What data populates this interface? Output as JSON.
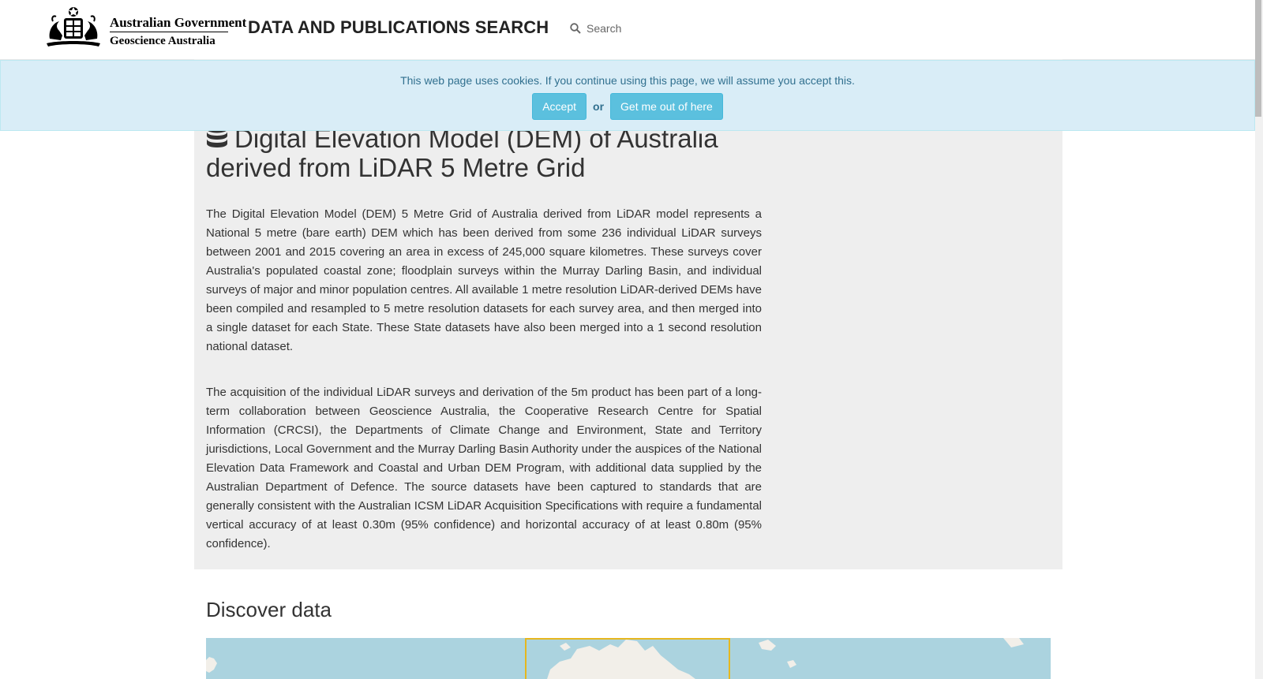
{
  "header": {
    "logo_line_1": "Australian Government",
    "logo_line_2": "Geoscience Australia",
    "site_title": "DATA AND PUBLICATIONS SEARCH",
    "search_label": "Search",
    "search_icon": "search-icon"
  },
  "cookie_banner": {
    "message": "This web page uses cookies. If you continue using this page, we will assume you accept this.",
    "accept_label": "Accept",
    "or_label": "or",
    "opt_out_label": "Get me out of here"
  },
  "record": {
    "icon": "database-icon",
    "title": "Digital Elevation Model (DEM) of Australia derived from LiDAR 5 Metre Grid",
    "paragraph_1": "The Digital Elevation Model (DEM) 5 Metre Grid of Australia derived from LiDAR model represents a National 5 metre (bare earth) DEM which has been derived from some 236 individual LiDAR surveys between 2001 and 2015 covering an area in excess of 245,000 square kilometres. These surveys cover Australia's populated coastal zone; floodplain surveys within the Murray Darling Basin, and individual surveys of major and minor population centres. All available 1 metre resolution LiDAR-derived DEMs have been compiled and resampled to 5 metre resolution datasets for each survey area, and then merged into a single dataset for each State. These State datasets have also been merged into a 1 second resolution national dataset.",
    "paragraph_2": "The acquisition of the individual LiDAR surveys and derivation of the 5m product has been part of a long-term collaboration between Geoscience Australia, the Cooperative Research Centre for Spatial Information (CRCSI), the Departments of Climate Change and Environment, State and Territory jurisdictions, Local Government and the Murray Darling Basin Authority under the auspices of the National Elevation Data Framework and Coastal and Urban DEM Program, with additional data supplied by the Australian Department of Defence. The source datasets have been captured to standards that are generally consistent with the Australian ICSM LiDAR Acquisition Specifications with require a fundamental vertical accuracy of at least 0.30m (95% confidence) and horizontal accuracy of at least 0.80m (95% confidence)."
  },
  "discover": {
    "heading": "Discover data"
  },
  "colors": {
    "cookie_bg": "#d9edf7",
    "cookie_text": "#31708f",
    "button": "#5bc0de",
    "panel_bg": "#eeeeee",
    "map_water": "#abd3df",
    "map_extent": "#e6b71f"
  }
}
